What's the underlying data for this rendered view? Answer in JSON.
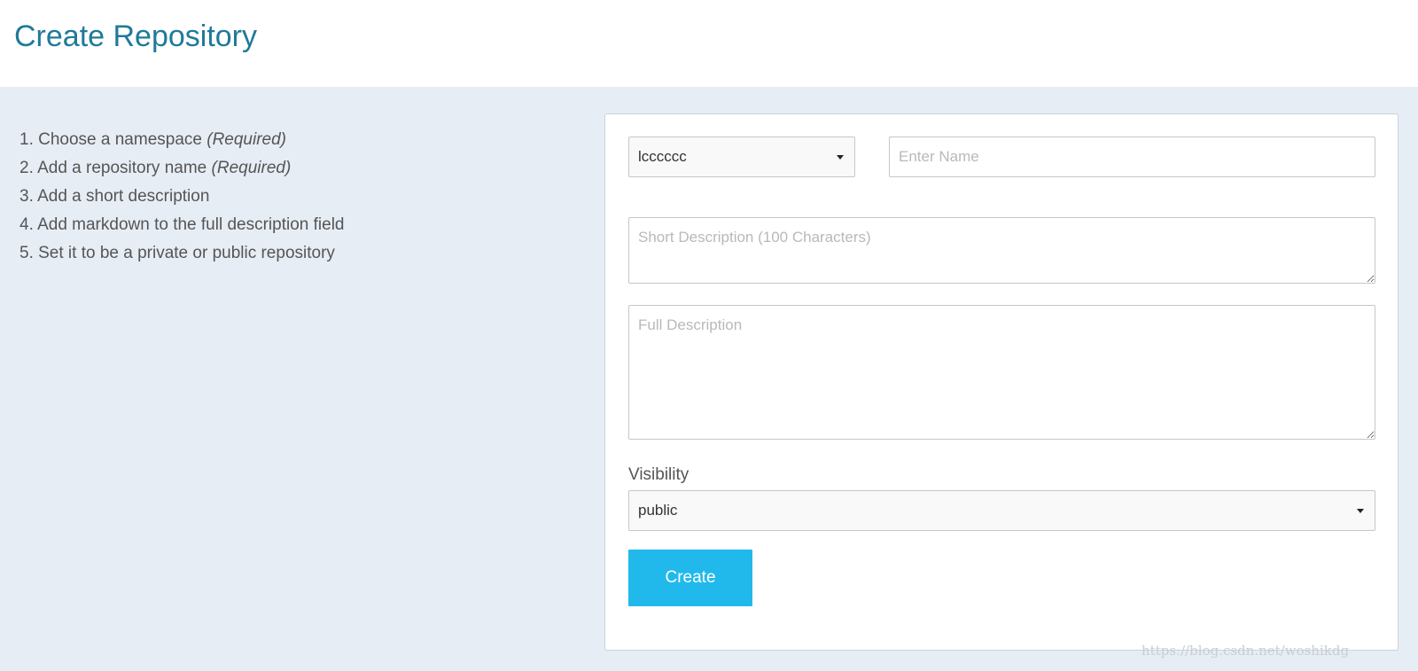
{
  "header": {
    "title": "Create Repository"
  },
  "steps": [
    {
      "text": "1. Choose a namespace ",
      "note": "(Required)"
    },
    {
      "text": "2. Add a repository name ",
      "note": "(Required)"
    },
    {
      "text": "3. Add a short description",
      "note": ""
    },
    {
      "text": "4. Add markdown to the full description field",
      "note": ""
    },
    {
      "text": "5. Set it to be a private or public repository",
      "note": ""
    }
  ],
  "form": {
    "namespace": {
      "value": "lcccccc"
    },
    "name": {
      "placeholder": "Enter Name",
      "value": ""
    },
    "short_description": {
      "placeholder": "Short Description (100 Characters)"
    },
    "full_description": {
      "placeholder": "Full Description"
    },
    "visibility": {
      "label": "Visibility",
      "value": "public"
    },
    "create_label": "Create"
  },
  "watermark": "https://blog.csdn.net/woshikdg",
  "colors": {
    "accent": "#21b9ec",
    "title": "#1f7a99",
    "background": "#e7edf5"
  }
}
